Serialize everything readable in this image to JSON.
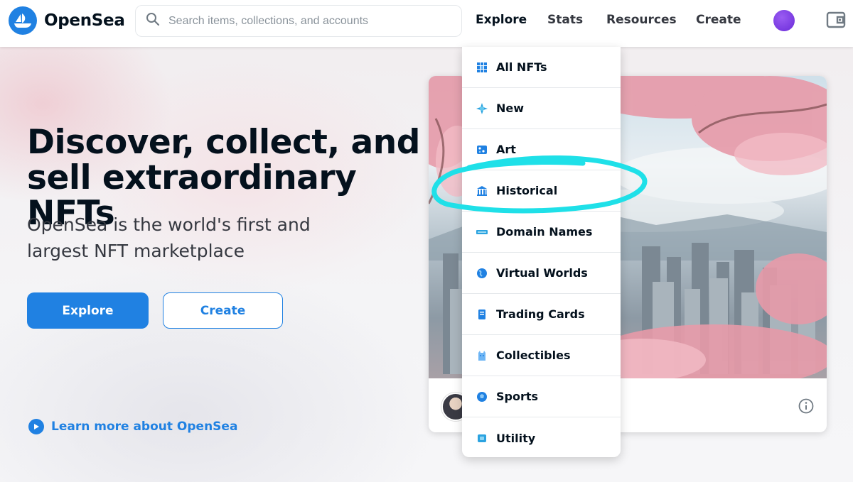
{
  "header": {
    "brand": "OpenSea",
    "search_placeholder": "Search items, collections, and accounts",
    "nav": [
      "Explore",
      "Stats",
      "Resources",
      "Create"
    ]
  },
  "hero": {
    "title": "Discover, collect, and sell extraordinary NFTs",
    "subtitle": "OpenSea is the world's first and largest NFT marketplace",
    "explore_label": "Explore",
    "create_label": "Create",
    "learn_more": "Learn more about OpenSea"
  },
  "explore_menu": {
    "items": [
      {
        "label": "All NFTs",
        "icon": "grid-icon"
      },
      {
        "label": "New",
        "icon": "sparkle-icon"
      },
      {
        "label": "Art",
        "icon": "palette-icon"
      },
      {
        "label": "Historical",
        "icon": "museum-icon"
      },
      {
        "label": "Domain Names",
        "icon": "domain-icon"
      },
      {
        "label": "Virtual Worlds",
        "icon": "globe-icon"
      },
      {
        "label": "Trading Cards",
        "icon": "card-icon"
      },
      {
        "label": "Collectibles",
        "icon": "collectible-icon"
      },
      {
        "label": "Sports",
        "icon": "ball-icon"
      },
      {
        "label": "Utility",
        "icon": "utility-icon"
      }
    ],
    "highlighted_item": "Historical"
  },
  "colors": {
    "brand_blue": "#2081e2",
    "highlight_cyan": "#1fe0e8",
    "text_dark": "#04111d"
  }
}
